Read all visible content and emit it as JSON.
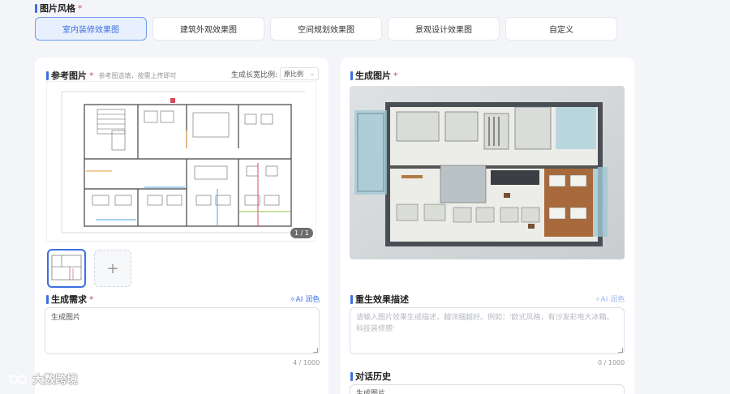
{
  "style_section": {
    "title": "图片风格",
    "required_mark": "*",
    "tabs": [
      {
        "label": "室内装修效果图",
        "active": true
      },
      {
        "label": "建筑外观效果图",
        "active": false
      },
      {
        "label": "空间规划效果图",
        "active": false
      },
      {
        "label": "景观设计效果图",
        "active": false
      },
      {
        "label": "自定义",
        "active": false
      }
    ]
  },
  "reference": {
    "title": "参考图片",
    "required_mark": "*",
    "hint": "参考图选填，按需上传即可",
    "ratio_label": "生成长宽比例:",
    "ratio_value": "原比例",
    "page_indicator": "1 / 1",
    "add_icon": "+"
  },
  "requirement": {
    "title": "生成需求",
    "required_mark": "*",
    "polish_label": "AI 润色",
    "value": "生成图片",
    "counter": "4 / 1000"
  },
  "generated": {
    "title": "生成图片",
    "required_mark": "*"
  },
  "regen": {
    "title": "重生效果描述",
    "polish_label": "AI 润色",
    "placeholder": "请输入图片效果生成描述，越详细越好。例如：'欧式风格，有沙发彩电大冰箱，科技装修感'",
    "counter": "0 / 1000"
  },
  "history": {
    "title": "对话历史",
    "first_item": "生成图片"
  },
  "watermark": {
    "text": "大数跨境"
  },
  "colors": {
    "accent": "#3d6fe0",
    "required": "#e5484d"
  }
}
